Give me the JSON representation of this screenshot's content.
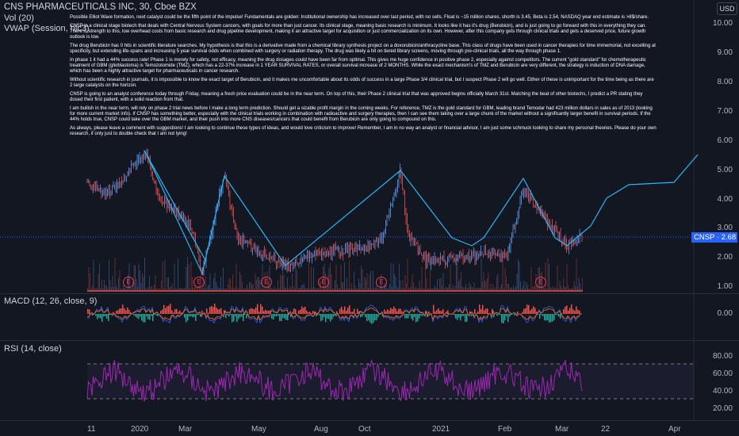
{
  "header": {
    "title": "CNS PHARMACEUTICALS INC, 30, Cboe BZX",
    "vol": "Vol (20)",
    "vwap": "VWAP (Session, hlc3)",
    "currency": "USD"
  },
  "price_axis": [
    "10.00",
    "9.00",
    "8.00",
    "7.00",
    "6.00",
    "5.00",
    "4.00",
    "3.00",
    "2.00",
    "1.00"
  ],
  "price_tag": "CNSP · 2.68",
  "macd": {
    "title": "MACD (12, 26, close, 9)",
    "axis": [
      "0.00"
    ]
  },
  "rsi": {
    "title": "RSI (14, close)",
    "axis": [
      "80.00",
      "60.00",
      "40.00",
      "20.00"
    ]
  },
  "time_axis": [
    "11",
    "2020",
    "Mar",
    "May",
    "Aug",
    "Oct",
    "2021",
    "Feb",
    "Mar",
    "22",
    "Apr"
  ],
  "earnings_marker": "E",
  "notes": [
    "Possible Elliot Wave formation, next catalyst could be the fifth point of the impulse! Fundamentals are golden: Institutional ownership has increased over last period, with no sells. Float is ~15 million shares, shorth is 3.45, Beta is 2.54, NASDAQ year end estimate is >8$/share.",
    "CNSP is a clinical stage biotech that deals with Central Nervous System cancers, with goals for more than just cancer. Its clinical stage, meaning basic research is minimum. It looks like it has it's drug (Berubicin), and is just going to go forward with this in everything they can. There is strength to this, low overhead costs from basic research and drug pipeline development, making it an attractive target for acquisition or just commercialization on its own. However, after this company gets through clinical trials and gets a deserved price, future growth outlook is low.",
    "The drug Berubicin has 0 hits in scientific literature searches. My hypothesis is that this is a derivative made from a chemical library synthesis project on a doxorubicin/anthracycline base. This class of drugs have been used in cancer therapies for time immemorial, not excelling at specificity, but extending life-spans and increasing 5 year survival odds when combined with surgery or radiation therapy. The drug was likely a hit on tiered library screens, moving through pre-clinical trials, all the way through phase 1.",
    "In phase 1 it had a 44% success rate! Phase 1 is merely for safety, not efficacy, meaning the drug dosages could have been far from optimal. This gives me huge confidence in positive phase 2, especially against competitors. The current \"gold standard\" for chemotherapeutic treatment of GBM (glioblastoma) is Temozolomide (TMZ), which has a 22-37% increase in 1 YEAR SURVIVAL RATES, or overall survival increase of 2 MONTHS. While the exact mechanism's of TMZ and Berubicin are very different, the strategy is induction of DNA damage, which has been a highly attractive target for pharmaceuticals in cancer research.",
    "Without scientific research in journals, it is impossible to know the exact target of Berubicin, and it makes me uncomfortable about its odds of success in a large Phase 3/4 clinical trial, but I suspect Phase 2 will go well. Either of these is unimportant for the time being as there are 2 large catalysts on the horizon.",
    "CNSP is going to an analyst conference today through Friday, meaning a fresh price evaluation could be in the near term. On top of this, their Phase 2 clinical trial that was approved begins officially March 31st. Matching the beat of other biotechs, I predict a PR stating they dosed their first patient, with a solid reaction from that.",
    "I am bullish in the near term, will rely on phase 2 trial news before I make a long term prediction. Should get a sizable profit margin in the coming weeks. For reference, TMZ is the gold standard for GBM, leading brand Temodar had 423 million dollars in sales as of 2013 (looking for more current market info). If CNSP has something better, especially with the clinical trials working in combination with radioactive and surgery therapies, then I can see them taking over a large chunk of the market without a significantly larger benefit in survival periods. If the 44% holds true, CNSP could take over the GBM market, and their push into more CNS diseases/cancers that could benefit from Berubicin are only going to compound on this.",
    "As always, please leave a comment with suggestions! I am looking to continue these types of ideas, and would love criticism to improve! Remember, I am in no way an analyst or financial advisor, I am just some schmuck looking to share my personal theories. Please do your own research, if only just to double check that I am not lying!"
  ],
  "colors": {
    "bg": "#131722",
    "candle_up": "#5b9cf6",
    "candle_down": "#ef5350",
    "wave": "#29b6f6",
    "rsi": "#9c27b0",
    "price_tag": "#2962ff"
  }
}
